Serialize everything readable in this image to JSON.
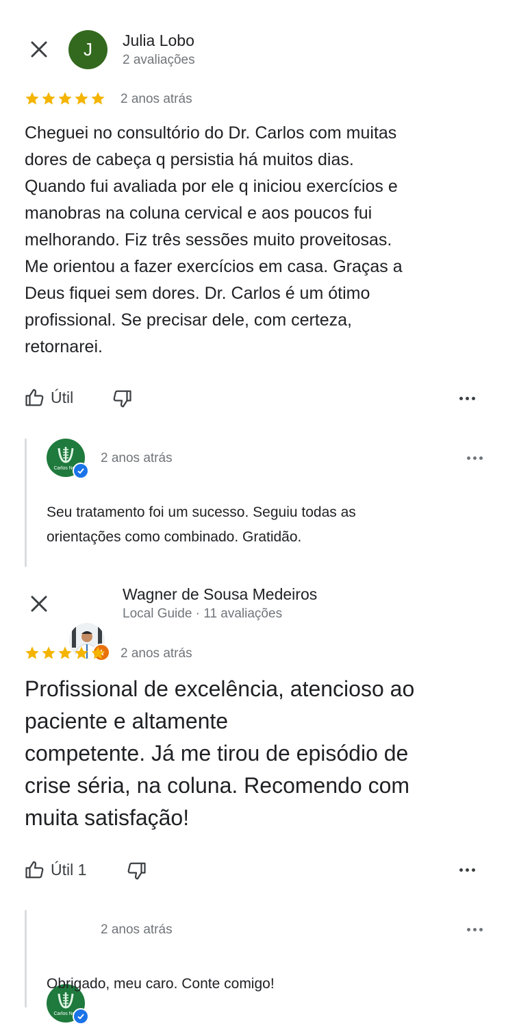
{
  "reviews": [
    {
      "author": "Julia Lobo",
      "avatar_letter": "J",
      "subtitle": "2 avaliações",
      "rating": 5,
      "time": "2 anos atrás",
      "text": "Cheguei no consultório do Dr. Carlos com muitas\ndores de cabeça q persistia há muitos dias.\nQuando fui avaliada por ele q iniciou exercícios e\nmanobras na coluna cervical e aos poucos fui\nmelhorando. Fiz três sessões muito proveitosas.\nMe orientou a fazer exercícios em casa. Graças a\nDeus fiquei sem dores. Dr. Carlos é um ótimo\nprofissional. Se precisar dele, com certeza,\nretornarei.",
      "helpful_label": "Útil",
      "reply": {
        "owner_logo_text": "Carlos Nob",
        "time": "2 anos atrás",
        "text": "Seu tratamento foi um sucesso. Seguiu todas as\norientações como combinado. Gratidão."
      }
    },
    {
      "author": "Wagner de Sousa Medeiros",
      "subtitle": "Local Guide · 11 avaliações",
      "rating": 5,
      "time": "2 anos atrás",
      "text": "Profissional de excelência, atencioso ao\npaciente e altamente\ncompetente.  Já me tirou de episódio de\ncrise  séria, na coluna. Recomendo com\nmuita satisfação!",
      "helpful_label": "Útil 1",
      "reply": {
        "owner_logo_text": "Carlos Nob",
        "time": "2 anos atrás",
        "text": "Obrigado, meu caro. Conte comigo!"
      }
    }
  ],
  "colors": {
    "star": "#f4b400",
    "verified": "#1a73e8",
    "local_guide": "#e8710a",
    "avatar_green": "#33691e"
  },
  "icons": [
    "close-icon",
    "star-icon",
    "thumbs-up-icon",
    "thumbs-down-icon",
    "more-icon",
    "verified-icon",
    "local-guide-badge-icon"
  ]
}
